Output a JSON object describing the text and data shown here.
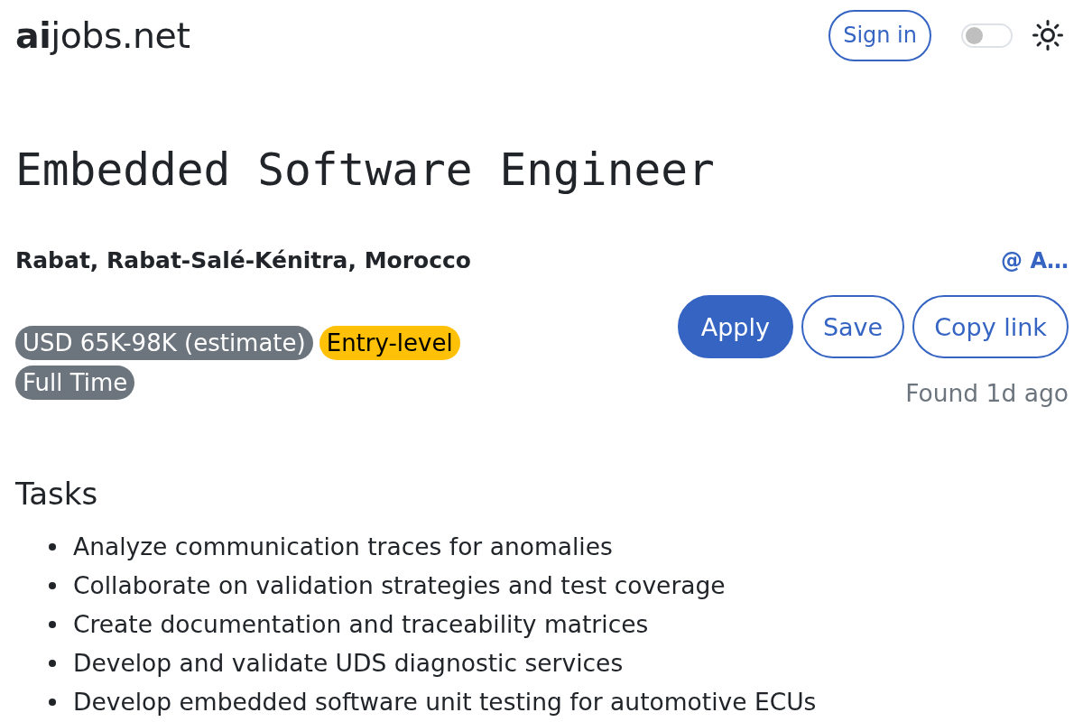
{
  "header": {
    "logo": "**ai**jobs.net",
    "sign_in": "Sign in",
    "theme_toggle": {
      "on": false
    }
  },
  "job": {
    "title": "Embedded Software Engineer",
    "location": "Rabat, Rabat-Salé-Kénitra, Morocco",
    "company": "@ A…",
    "tags": [
      {
        "label": "USD 65K-98K (estimate)",
        "color": "#6c757d"
      },
      {
        "label": "Entry-level",
        "color": "#ffc107"
      },
      {
        "label": "Full Time",
        "color": "#6c757d"
      }
    ],
    "actions": [
      {
        "label": "Apply",
        "kind": "primary"
      },
      {
        "label": "Save",
        "kind": "outline"
      },
      {
        "label": "Copy link",
        "kind": "outline"
      }
    ],
    "found": "Found 1d ago"
  },
  "sections": [
    {
      "heading": "Tasks",
      "items": [
        "Analyze communication traces for anomalies",
        "Collaborate on validation strategies and test coverage",
        "Create documentation and traceability matrices",
        "Develop and validate UDS diagnostic services",
        "Develop embedded software unit testing for automotive ECUs"
      ]
    }
  ]
}
